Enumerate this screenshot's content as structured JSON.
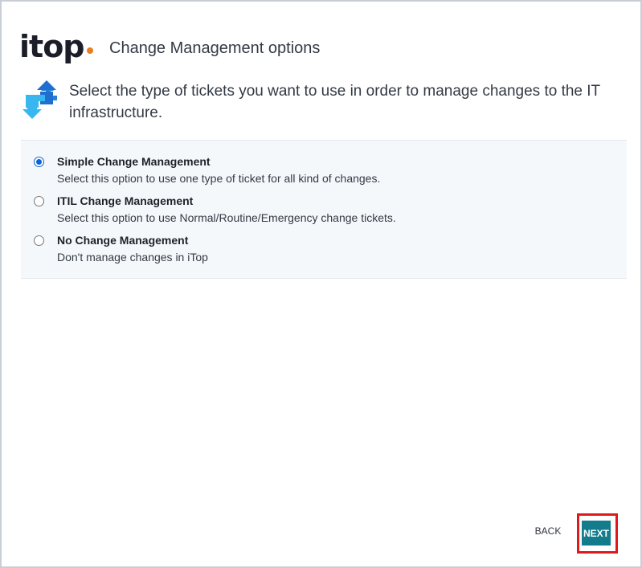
{
  "header": {
    "logo_text": "itop",
    "title": "Change Management options"
  },
  "intro": {
    "icon": "change-arrows-icon",
    "text": "Select the type of tickets you want to use in order to manage changes to the IT infrastructure."
  },
  "options": [
    {
      "title": "Simple Change Management",
      "description": "Select this option to use one type of ticket for all kind of changes.",
      "selected": true
    },
    {
      "title": "ITIL Change Management",
      "description": "Select this option to use Normal/Routine/Emergency change tickets.",
      "selected": false
    },
    {
      "title": "No Change Management",
      "description": "Don't manage changes in iTop",
      "selected": false
    }
  ],
  "buttons": {
    "back_label": "BACK",
    "next_label": "NEXT"
  },
  "colors": {
    "accent": "#137c8c",
    "logo_dot": "#ea7d1e",
    "radio_selected": "#0b63d8",
    "highlight_box": "#e0191b"
  }
}
